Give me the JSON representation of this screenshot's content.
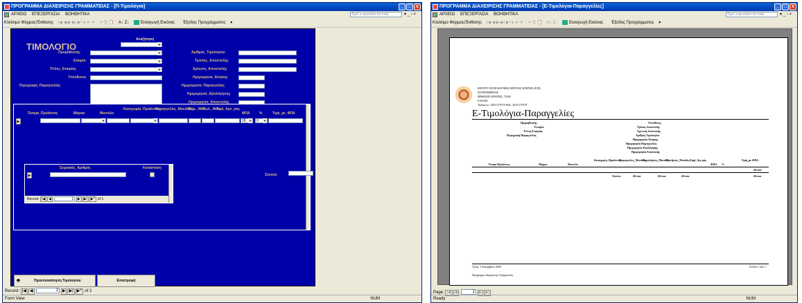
{
  "w1": {
    "title": "ΠΡΟΓΡΑΜΜΑ ΔΙΑΧΕΙΡΙΣΗΣ ΓΡΑΜΜΑΤΕΙΑΣ - [Π-Τιμολόγια]",
    "menu": [
      "ΑΡΧΕΙΟ",
      "ΕΠΕΞΕΡΓΑΣΙΑ",
      "ΒΟΗΘΗΤΙΚΑ"
    ],
    "help_placeholder": "Type a question for help",
    "toolbar": {
      "form_label": "Κλείσιμο Φόρμας/Έκθεσης",
      "insert_image": "Εισαγωγή Εικόνας",
      "exit": "Έξοδος Προγράμματος"
    },
    "form": {
      "title": "ΤΙΜΟΛΟΓΙΟ",
      "search_label": "Αναζήτηση",
      "left_labels": [
        "Προμηθευτής",
        "Εταιρία",
        "Τίτλος_Εταιρίας",
        "Υπεύθυνος",
        "Περιγραφή_Παραγγελίας"
      ],
      "right_labels": [
        "Αριθμός_Τιμολογίου",
        "Τρόπος_Αποστολής",
        "Χρέωση_Αποστολής",
        "Ημερομηνία_Αίτησης",
        "Ημερομηνία_Παραγγελίας",
        "Ημερομηνία_Αξιολόγησης",
        "Ημερομηνία_Αποστολής"
      ],
      "columns": [
        "Όνομα_Προϊόντος",
        "Μάρκα",
        "Μοντέλο",
        "Κατηγορία_Προϊόντος",
        "Παραγγελίες_Μονάδες",
        "Παρ._Μον",
        "Πωλ._Μον",
        "Τιμή_Αγο_ράς",
        "ΦΠΑ",
        "%",
        "Τιμή_με_ΦΠΑ"
      ],
      "vat": "18",
      "pct": "0",
      "serial_label": "Σειριακός_Αριθμός",
      "status_label": "Κατάσταση",
      "total_label": "Σύνολο",
      "sub_record": {
        "label": "Record:",
        "current": "1",
        "of": "of 1"
      },
      "preview_button": "Προεπισκόπηση Τιμολογίου",
      "back_button": "Επιστροφή"
    },
    "nav": {
      "label": "Record:",
      "current": "2",
      "of": "of 2"
    },
    "status": "Form View",
    "num": "NUM"
  },
  "w2": {
    "title": "ΠΡΟΓΡΑΜΜΑ ΔΙΑΧΕΙΡΙΣΗΣ ΓΡΑΜΜΑΤΕΙΑΣ - [Ε-Τιμολόγια-Παραγγελίες]",
    "menu": [
      "ΑΡΧΕΙΟ",
      "ΕΠΕΞΕΡΓΑΣΙΑ",
      "ΒΟΗΘΗΤΙΚΑ"
    ],
    "help_placeholder": "Type a question for help",
    "toolbar": {
      "form_label": "Κλείσιμο Φόρμας/Έκθεσης",
      "insert_image": "Εισαγωγή Εικόνας",
      "exit": "Έξοδος Προγράμματος"
    },
    "report": {
      "org": [
        "ΚΕΝΤΡΟ ΤΕΧΝΟΛΟΓΙΚΗΣ ΕΡΕΥΝΑΣ ΚΡΗΤΗΣ (ΚΤΕ)",
        "ΕΣΤΑΥΡΩΜΕΝΟΣ",
        "ΗΡΑΚΛΕΙΟ ΚΡΗΤΗΣ, 71004",
        "ΕΛΛΑΔΑ",
        "Τηλέφωνο: 2810-379378 Φαξ: 2810-379378"
      ],
      "title": "Ε-Τιμολόγια-Παραγγελίες",
      "left_fields": [
        "Προμηθευτής",
        "Εταιρία",
        "Τίτλος Εταιρίας",
        "Περιγραφή Παραγγελίας"
      ],
      "right_fields": [
        "Υπεύθυνος",
        "Τρόπος Αποστολής",
        "Χρέωση Αποστολής",
        "Αριθμός Τιμολογίου",
        "Ημερομηνία Αίτησης",
        "Ημερομηνία Παραγγελίας",
        "Ημερομηνία Αξιολόγησης",
        "Ημερομηνία Αποστολής"
      ],
      "columns": [
        "Όνομα Προϊόντος",
        "Μάρκα",
        "Μοντέλο",
        "Κατηγορία_Προϊόντος",
        "Παραγγελίες_Μονάδες",
        "Παραλήψεις_Μονάδες",
        "Πωλήσεις_Μονάδες",
        "Τιμή_Αγο ράς",
        "ΦΠΑ",
        "%",
        "Τιμή_με ΦΠΑ"
      ],
      "err": "#Error",
      "sum_label": "Σύνολο",
      "footer_date": "Τρίτη, 5 Δεκεμβρίου 2006",
      "footer_page": "Σελίδα 1 από 1",
      "footer_app": "Πρόγραμμα Διαχείρισης Γραμματείας"
    },
    "page_nav": {
      "label": "Page:",
      "current": "1"
    },
    "status": "Ready",
    "num": "NUM"
  }
}
